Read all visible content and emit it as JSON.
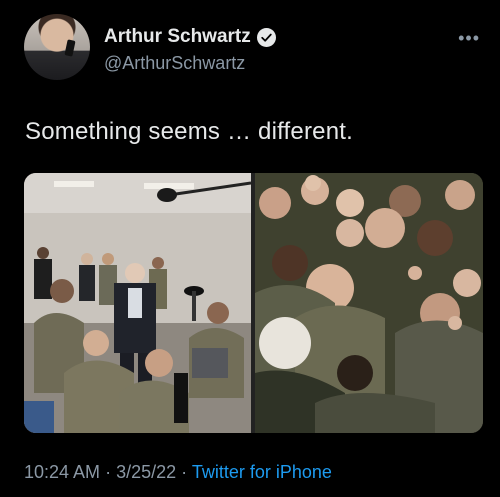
{
  "author": {
    "display_name": "Arthur Schwartz",
    "handle": "@ArthurSchwartz",
    "verified": true
  },
  "tweet": {
    "text": "Something seems … different.",
    "time": "10:24 AM",
    "separator": "·",
    "date": "3/25/22",
    "source": "Twitter for iPhone"
  },
  "icons": {
    "more": "more-options-icon",
    "verified": "verified-badge-icon"
  },
  "colors": {
    "background": "#000000",
    "primary_text": "#e7e9ea",
    "secondary_text": "#8b98a5",
    "link": "#1d9bf0"
  }
}
